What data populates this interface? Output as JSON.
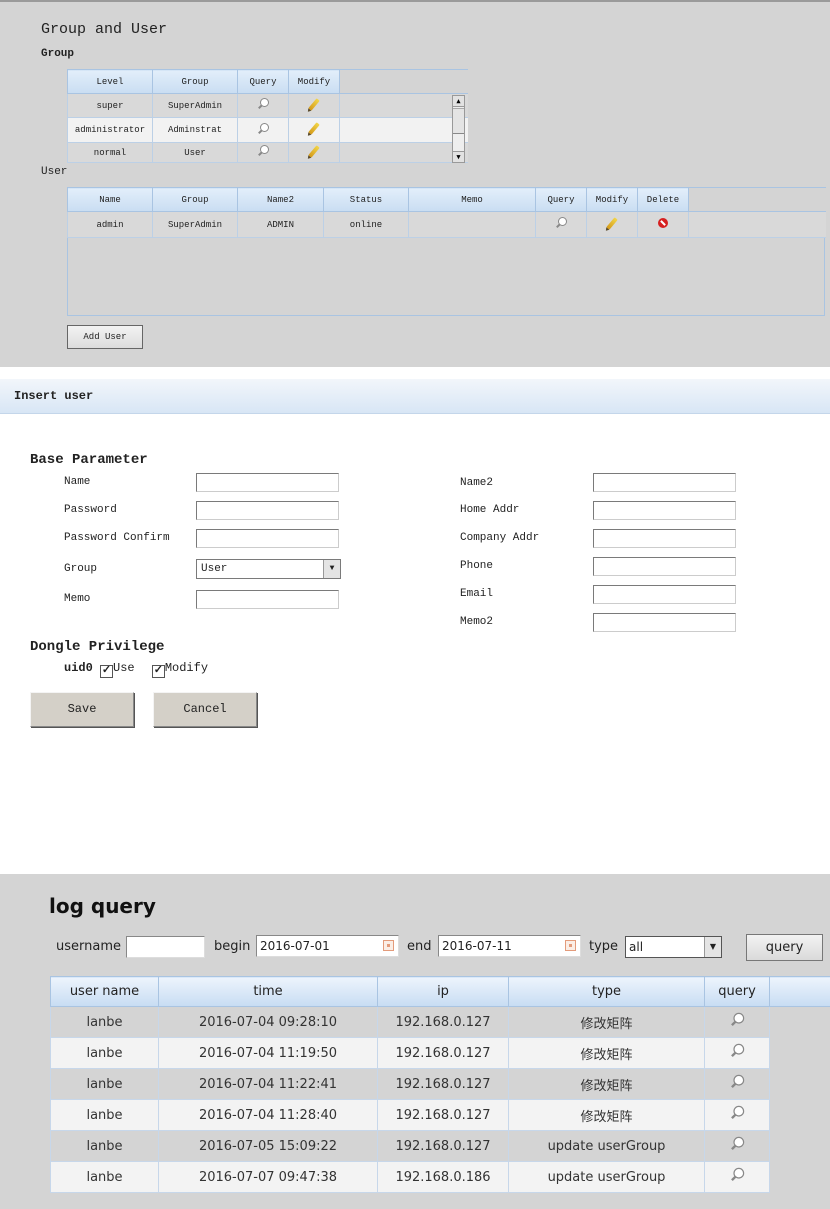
{
  "group_user": {
    "title": "Group and User",
    "group_heading": "Group",
    "group_columns": [
      "Level",
      "Group",
      "Query",
      "Modify"
    ],
    "group_rows": [
      {
        "level": "super",
        "group": "SuperAdmin"
      },
      {
        "level": "administrator",
        "group": "Adminstrat"
      },
      {
        "level": "normal",
        "group": "User"
      }
    ],
    "user_heading": "User",
    "user_columns": [
      "Name",
      "Group",
      "Name2",
      "Status",
      "Memo",
      "Query",
      "Modify",
      "Delete"
    ],
    "user_rows": [
      {
        "name": "admin",
        "group": "SuperAdmin",
        "name2": "ADMIN",
        "status": "online",
        "memo": ""
      }
    ],
    "add_user_label": "Add User"
  },
  "insert_user": {
    "title": "Insert user",
    "base_heading": "Base Parameter",
    "left_fields": {
      "name": "Name",
      "password": "Password",
      "password_confirm": "Password Confirm",
      "group": "Group",
      "memo": "Memo"
    },
    "group_selected": "User",
    "right_fields": {
      "name2": "Name2",
      "home_addr": "Home Addr",
      "company_addr": "Company Addr",
      "phone": "Phone",
      "email": "Email",
      "memo2": "Memo2"
    },
    "dongle_heading": "Dongle Privilege",
    "dongle_uid": "uid0",
    "use_label": "Use",
    "use_checked": true,
    "modify_label": "Modify",
    "modify_checked": true,
    "save_label": "Save",
    "cancel_label": "Cancel"
  },
  "log_query": {
    "title": "log query",
    "username_label": "username",
    "username_value": "",
    "begin_label": "begin",
    "begin_value": "2016-07-01",
    "end_label": "end",
    "end_value": "2016-07-11",
    "type_label": "type",
    "type_value": "all",
    "query_button": "query",
    "columns": [
      "user name",
      "time",
      "ip",
      "type",
      "query"
    ],
    "rows": [
      {
        "user": "lanbe",
        "time": "2016-07-04 09:28:10",
        "ip": "192.168.0.127",
        "type": "修改矩阵"
      },
      {
        "user": "lanbe",
        "time": "2016-07-04 11:19:50",
        "ip": "192.168.0.127",
        "type": "修改矩阵"
      },
      {
        "user": "lanbe",
        "time": "2016-07-04 11:22:41",
        "ip": "192.168.0.127",
        "type": "修改矩阵"
      },
      {
        "user": "lanbe",
        "time": "2016-07-04 11:28:40",
        "ip": "192.168.0.127",
        "type": "修改矩阵"
      },
      {
        "user": "lanbe",
        "time": "2016-07-05 15:09:22",
        "ip": "192.168.0.127",
        "type": "update userGroup"
      },
      {
        "user": "lanbe",
        "time": "2016-07-07 09:47:38",
        "ip": "192.168.0.186",
        "type": "update userGroup"
      }
    ]
  }
}
